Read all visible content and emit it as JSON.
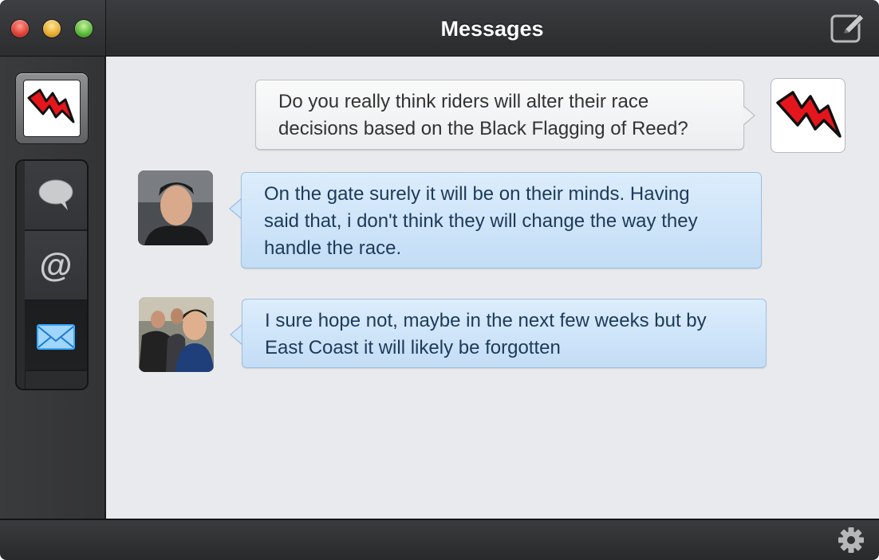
{
  "window": {
    "title": "Messages"
  },
  "colors": {
    "bubble_in": "#c8e0f8",
    "bubble_out": "#f4f5f6",
    "accent": "#3aa8ff",
    "logo_red": "#e4161c"
  },
  "sidebar": {
    "items": [
      {
        "name": "profile",
        "icon": "logo-icon"
      },
      {
        "name": "conversations",
        "icon": "speech-bubble-icon"
      },
      {
        "name": "mentions",
        "icon": "at-sign-icon"
      },
      {
        "name": "direct-messages",
        "icon": "envelope-icon",
        "active": true
      }
    ]
  },
  "messages": [
    {
      "direction": "outgoing",
      "text_line1": "Do you really think riders will alter their race",
      "text_line2": "decisions based on the Black Flagging of Reed?"
    },
    {
      "direction": "incoming",
      "text_line1": "On the gate surely it will be on their minds. Having",
      "text_line2": "said that, i don't think they will change the way they",
      "text_line3": "handle the race."
    },
    {
      "direction": "incoming",
      "text_line1": "I sure hope not, maybe in the next few weeks but by",
      "text_line2": "East Coast it will likely be forgotten"
    }
  ],
  "toolbar": {
    "compose_icon": "compose-icon",
    "settings_icon": "gear-icon"
  }
}
